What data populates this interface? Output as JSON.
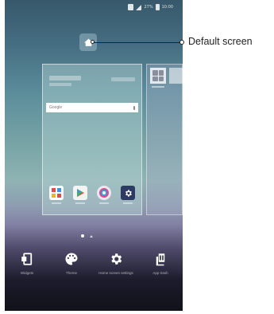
{
  "status_bar": {
    "time": "10:00",
    "battery": "27%"
  },
  "callout": {
    "label": "Default screen"
  },
  "home_preview": {
    "search": {
      "placeholder": "Google"
    },
    "dock_apps": [
      {
        "icon": "apps-grid-icon"
      },
      {
        "icon": "play-store-icon"
      },
      {
        "icon": "camera-icon"
      },
      {
        "icon": "settings-gear-icon"
      }
    ]
  },
  "page_indicator": {
    "pages": 2,
    "current": 1
  },
  "bottom_menu": [
    {
      "label": "Widgets",
      "icon": "widgets-icon"
    },
    {
      "label": "Theme",
      "icon": "palette-icon"
    },
    {
      "label": "Home screen settings",
      "icon": "gear-icon"
    },
    {
      "label": "App trash",
      "icon": "app-trash-icon"
    }
  ],
  "colors": {
    "wallpaper_top": "#37586a",
    "wallpaper_bottom": "#111119",
    "callout_text": "#222222"
  }
}
